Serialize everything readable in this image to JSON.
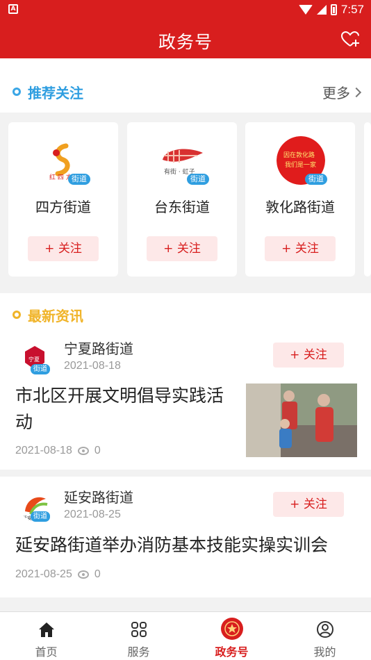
{
  "status_bar": {
    "time": "7:57",
    "app_glyph": "A"
  },
  "header": {
    "title": "政务号"
  },
  "recommended": {
    "title": "推荐关注",
    "more": "更多",
    "cards": [
      {
        "name": "四方街道",
        "badge": "街道",
        "follow": "+ 关注",
        "logo_color": "#f0a020"
      },
      {
        "name": "台东街道",
        "badge": "街道",
        "follow": "+ 关注",
        "logo_color": "#d83030"
      },
      {
        "name": "敦化路街道",
        "badge": "街道",
        "follow": "+ 关注",
        "logo_color": "#e01c1c"
      }
    ]
  },
  "news": {
    "title": "最新资讯",
    "items": [
      {
        "source": "宁夏路街道",
        "source_date": "2021-08-18",
        "badge": "街道",
        "follow": "+ 关注",
        "headline": "市北区开展文明倡导实践活动",
        "date": "2021-08-18",
        "views": "0",
        "has_thumb": true
      },
      {
        "source": "延安路街道",
        "source_date": "2021-08-25",
        "badge": "街道",
        "follow": "+ 关注",
        "headline": "延安路街道举办消防基本技能实操实训会",
        "date": "2021-08-25",
        "views": "0",
        "has_thumb": false
      }
    ]
  },
  "nav": {
    "items": [
      {
        "label": "首页",
        "icon": "home-icon"
      },
      {
        "label": "服务",
        "icon": "grid-icon"
      },
      {
        "label": "政务号",
        "icon": "emblem-icon",
        "active": true
      },
      {
        "label": "我的",
        "icon": "user-icon"
      }
    ]
  },
  "colors": {
    "brand": "#d81e1e",
    "accent_blue": "#2f9ee0",
    "accent_yellow": "#f0b429"
  }
}
